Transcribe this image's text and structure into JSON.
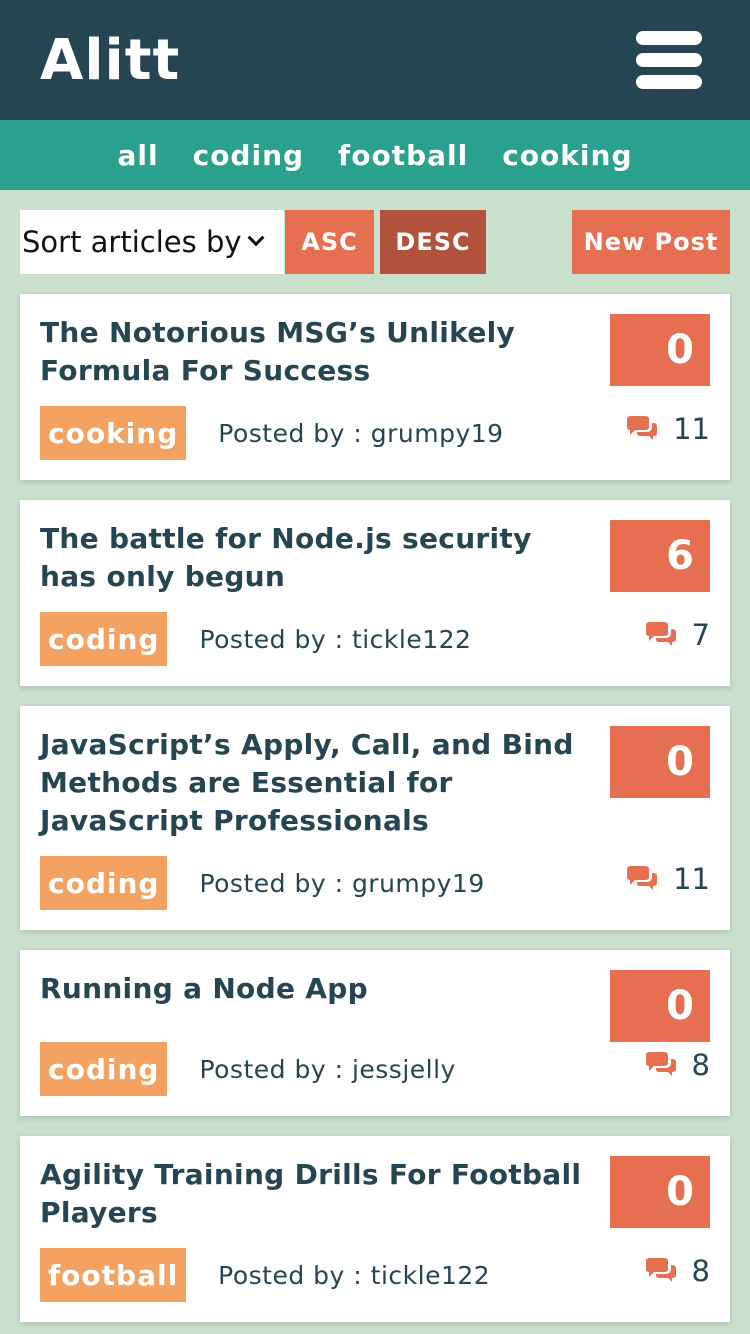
{
  "header": {
    "logo": "Alitt",
    "menu_icon": "hamburger-icon"
  },
  "topics": [
    "all",
    "coding",
    "football",
    "cooking"
  ],
  "controls": {
    "sort_label": "Sort articles by",
    "asc_label": "ASC",
    "desc_label": "DESC",
    "new_post_label": "New Post"
  },
  "colors": {
    "header_bg": "#264553",
    "topics_bg": "#2aa18e",
    "page_bg": "#c9e0cd",
    "accent": "#e76f51",
    "accent_dark": "#b1523c",
    "tag_bg": "#f4a261"
  },
  "articles": [
    {
      "title": "The Notorious MSG’s Unlikely Formula For Success",
      "topic": "cooking",
      "author": "Posted by : grumpy19",
      "votes": "0",
      "comments": "11"
    },
    {
      "title": "The battle for Node.js security has only begun",
      "topic": "coding",
      "author": "Posted by : tickle122",
      "votes": "6",
      "comments": "7"
    },
    {
      "title": "JavaScript’s Apply, Call, and Bind Methods are Essential for JavaScript Professionals",
      "topic": "coding",
      "author": "Posted by : grumpy19",
      "votes": "0",
      "comments": "11"
    },
    {
      "title": "Running a Node App",
      "topic": "coding",
      "author": "Posted by : jessjelly",
      "votes": "0",
      "comments": "8"
    },
    {
      "title": "Agility Training Drills For Football Players",
      "topic": "football",
      "author": "Posted by : tickle122",
      "votes": "0",
      "comments": "8"
    }
  ]
}
